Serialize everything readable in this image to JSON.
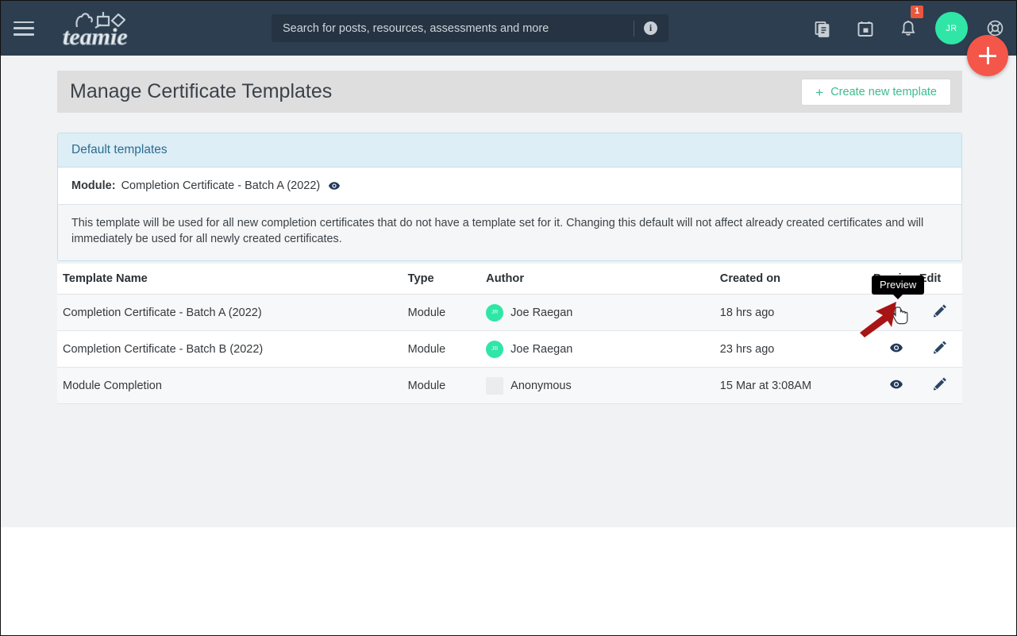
{
  "topnav": {
    "menu_icon": "hamburger-menu-icon",
    "logo_text": "teamie",
    "search": {
      "placeholder": "Search for posts, resources, assessments and more",
      "info_icon": "info-icon"
    },
    "icons": [
      {
        "name": "newsfeed-icon",
        "label": "Newsfeed"
      },
      {
        "name": "calendar-icon",
        "label": "Calendar"
      },
      {
        "name": "notifications-bell-icon",
        "label": "Notifications",
        "badge": "1"
      },
      {
        "name": "help-lifebuoy-icon",
        "label": "Help"
      }
    ],
    "avatar_initials": "JR",
    "fab": {
      "name": "create-fab-button",
      "label": "+"
    }
  },
  "header": {
    "title": "Manage Certificate Templates",
    "create_button": {
      "plus": "+",
      "label": "Create new template"
    }
  },
  "default_panel": {
    "heading": "Default templates",
    "module_label": "Module:",
    "module_value": "Completion Certificate - Batch A (2022)",
    "preview_icon": "eye-preview-icon",
    "note": "This template will be used for all new completion certificates that do not have a template set for it. Changing this default will not affect already created certificates and will immediately be used for all newly created certificates."
  },
  "table": {
    "columns": [
      "Template Name",
      "Type",
      "Author",
      "Created on",
      "Preview",
      "Edit"
    ],
    "rows": [
      {
        "name": "Completion Certificate - Batch A (2022)",
        "type": "Module",
        "author": "Joe Raegan",
        "author_initials": "JR",
        "author_anonymous": false,
        "created_on": "18 hrs ago",
        "preview_icon": "eye-preview-icon",
        "edit_icon": "pencil-edit-icon"
      },
      {
        "name": "Completion Certificate - Batch B (2022)",
        "type": "Module",
        "author": "Joe Raegan",
        "author_initials": "JR",
        "author_anonymous": false,
        "created_on": "23 hrs ago",
        "preview_icon": "eye-preview-icon",
        "edit_icon": "pencil-edit-icon"
      },
      {
        "name": "Module Completion",
        "type": "Module",
        "author": "Anonymous",
        "author_initials": "",
        "author_anonymous": true,
        "created_on": "15 Mar at 3:08AM",
        "preview_icon": "eye-preview-icon",
        "edit_icon": "pencil-edit-icon"
      }
    ]
  },
  "tooltip": {
    "text": "Preview"
  },
  "colors": {
    "nav_bg": "#2c3e50",
    "accent_green": "#3cbc8d",
    "avatar_green": "#2fe6a7",
    "fab_red": "#f4564a",
    "badge_red": "#e9573f",
    "panel_blue_bg": "#ddeef6",
    "panel_blue_text": "#2c6b92",
    "icon_navy": "#22395a",
    "annotation_red": "#a81414"
  }
}
